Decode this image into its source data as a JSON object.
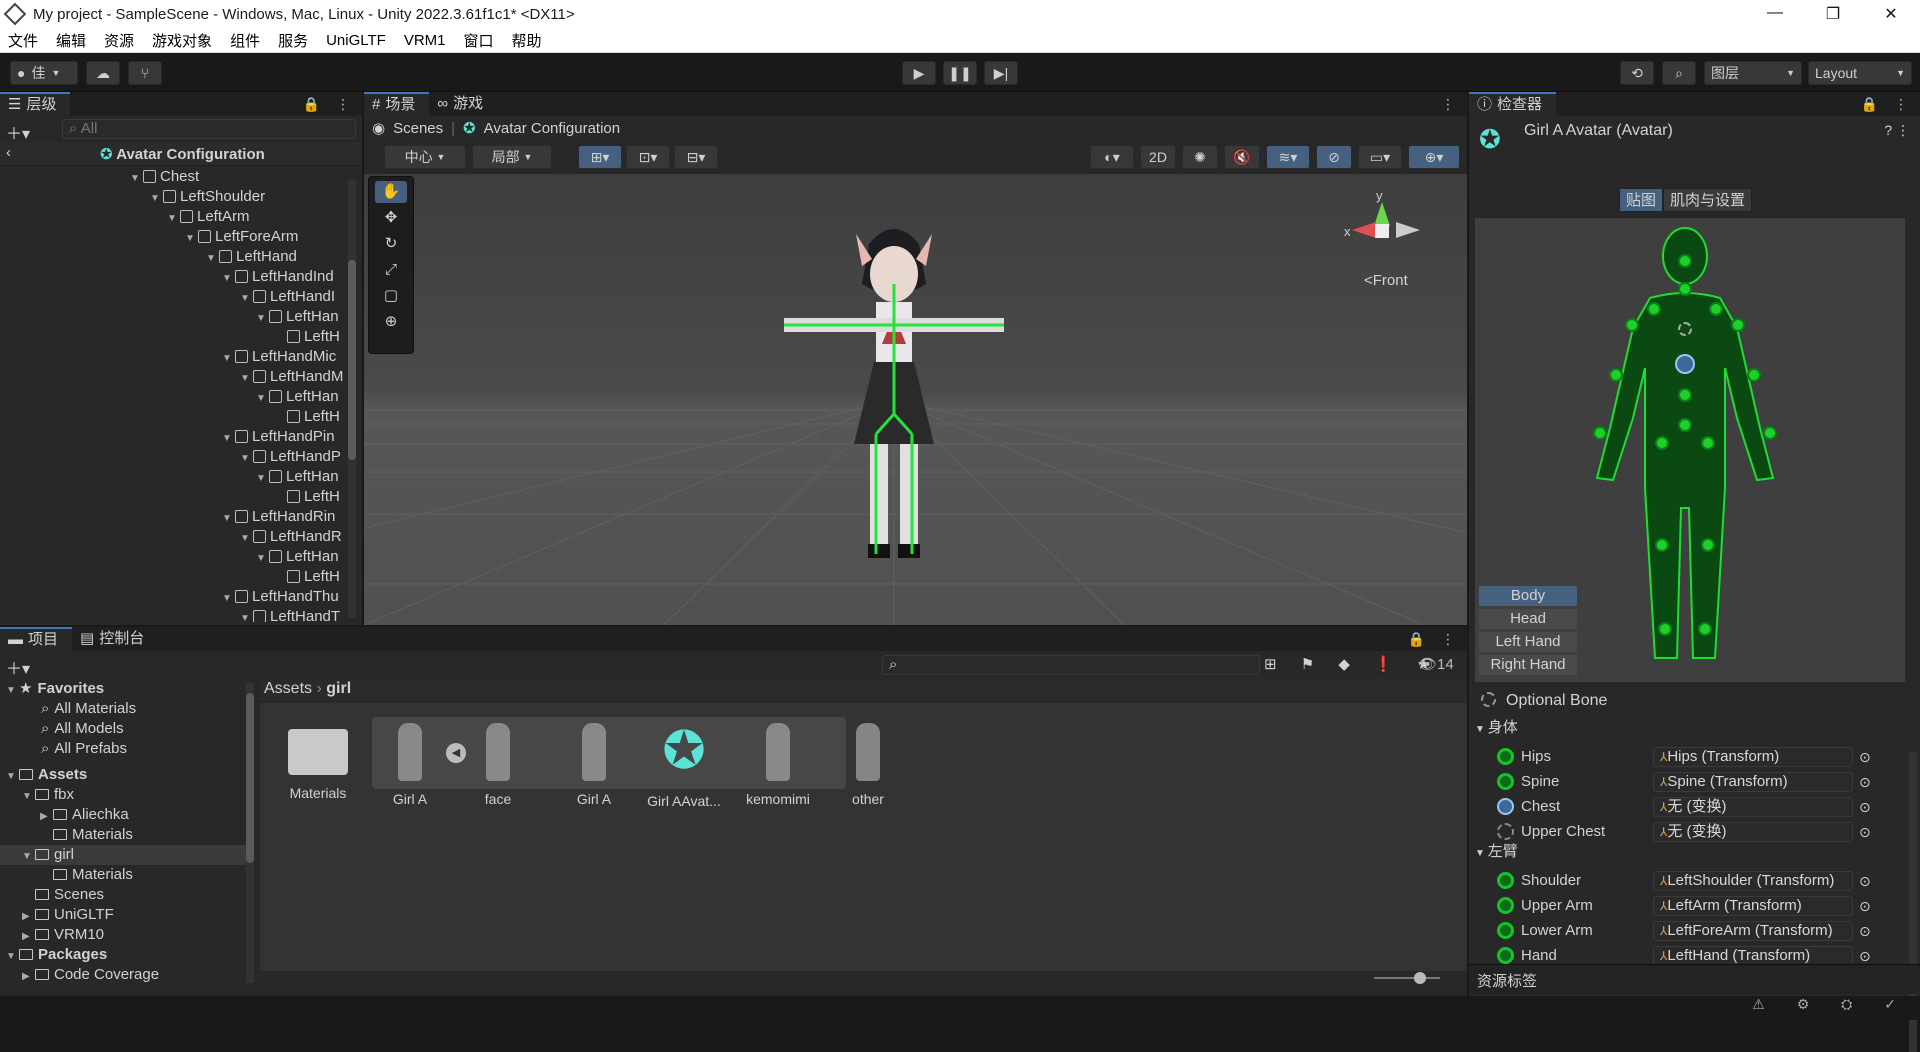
{
  "window": {
    "title": "My project - SampleScene - Windows, Mac, Linux - Unity 2022.3.61f1c1* <DX11>"
  },
  "menu": [
    "文件",
    "编辑",
    "资源",
    "游戏对象",
    "组件",
    "服务",
    "UniGLTF",
    "VRM1",
    "窗口",
    "帮助"
  ],
  "toolbar": {
    "account": "佳",
    "layers": "图层",
    "layout": "Layout"
  },
  "hierarchy": {
    "tab": "层级",
    "search_placeholder": "All",
    "title": "Avatar Configuration",
    "nodes": [
      "Chest",
      "LeftShoulder",
      "LeftArm",
      "LeftForeArm",
      "LeftHand",
      "LeftHandInd",
      "LeftHandI",
      "LeftHan",
      "LeftH",
      "LeftHandMic",
      "LeftHandM",
      "LeftHan",
      "LeftH",
      "LeftHandPin",
      "LeftHandP",
      "LeftHan",
      "LeftH",
      "LeftHandRin",
      "LeftHandR",
      "LeftHan",
      "LeftH",
      "LeftHandThu",
      "LeftHandT"
    ]
  },
  "scene": {
    "tab_scene": "场景",
    "tab_game": "游戏",
    "breadcrumb_root": "Scenes",
    "breadcrumb_current": "Avatar Configuration",
    "pivot": "中心",
    "space": "局部",
    "mode_2d": "2D",
    "gizmo_y": "y",
    "gizmo_x": "x",
    "gizmo_view": "<Front"
  },
  "project": {
    "tab_project": "项目",
    "tab_console": "控制台",
    "count": "14",
    "favorites_label": "Favorites",
    "favorites": [
      "All Materials",
      "All Models",
      "All Prefabs"
    ],
    "assets_label": "Assets",
    "tree": [
      "fbx",
      "Aliechka",
      "Materials",
      "girl",
      "Materials",
      "Scenes",
      "UniGLTF",
      "VRM10"
    ],
    "packages_label": "Packages",
    "packages": [
      "Code Coverage"
    ],
    "path": [
      "Assets",
      "girl"
    ],
    "items": [
      "Materials",
      "Girl A",
      "face",
      "Girl A",
      "Girl AAvat...",
      "kemomimi",
      "other"
    ]
  },
  "inspector": {
    "tab": "检查器",
    "object_title": "Girl A Avatar (Avatar)",
    "tab_mapping": "贴图",
    "tab_muscles": "肌肉与设置",
    "body_parts": [
      "Body",
      "Head",
      "Left Hand",
      "Right Hand"
    ],
    "optional_bone": "Optional Bone",
    "section_body": "身体",
    "section_left_arm": "左臂",
    "body_rows": [
      {
        "label": "Hips",
        "value": "Hips (Transform)"
      },
      {
        "label": "Spine",
        "value": "Spine (Transform)"
      },
      {
        "label": "Chest",
        "value": "无 (变换)"
      },
      {
        "label": "Upper Chest",
        "value": "无 (变换)"
      }
    ],
    "arm_rows": [
      {
        "label": "Shoulder",
        "value": "LeftShoulder (Transform)"
      },
      {
        "label": "Upper Arm",
        "value": "LeftArm (Transform)"
      },
      {
        "label": "Lower Arm",
        "value": "LeftForeArm (Transform)"
      },
      {
        "label": "Hand",
        "value": "LeftHand (Transform)"
      }
    ],
    "asset_labels": "资源标签"
  },
  "colors": {
    "accent": "#3a79bb",
    "bone_green": "#1bd12a",
    "avatar_cyan": "#5be3d7"
  }
}
